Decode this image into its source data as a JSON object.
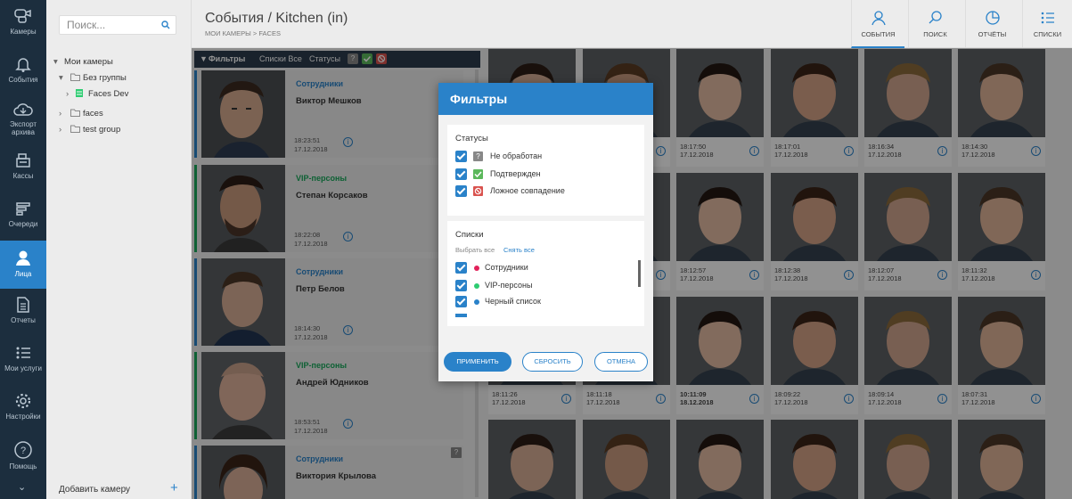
{
  "nav": {
    "items": [
      {
        "label": "Камеры",
        "icon": "cameras-icon"
      },
      {
        "label": "События",
        "icon": "bell-icon"
      },
      {
        "label": "Экспорт архива",
        "icon": "cloud-icon"
      },
      {
        "label": "Кассы",
        "icon": "cash-register-icon"
      },
      {
        "label": "Очереди",
        "icon": "queue-icon"
      },
      {
        "label": "Лица",
        "icon": "face-icon"
      },
      {
        "label": "Отчеты",
        "icon": "report-icon"
      },
      {
        "label": "Мои услуги",
        "icon": "services-icon"
      },
      {
        "label": "Настройки",
        "icon": "gear-icon"
      },
      {
        "label": "Помощь",
        "icon": "help-icon"
      }
    ],
    "active": "Лица"
  },
  "tree": {
    "search_placeholder": "Поиск...",
    "root": "Мои камеры",
    "nodes": [
      "Без группы",
      "Faces Dev",
      "faces",
      "test group"
    ],
    "add_camera": "Добавить камеру"
  },
  "header": {
    "title": "События / Kitchen (in)",
    "breadcrumb": "МОИ КАМЕРЫ > FACES",
    "tabs": [
      "СОБЫТИЯ",
      "ПОИСК",
      "ОТЧЁТЫ",
      "СПИСКИ"
    ]
  },
  "filterbar": {
    "filters": "Фильтры",
    "lists": "Списки Все",
    "statuses": "Статусы"
  },
  "events": [
    {
      "list": "Сотрудники",
      "name": "Виктор Мешков",
      "time": "18:23:51",
      "date": "17.12.2018"
    },
    {
      "list": "VIP-персоны",
      "name": "Степан Корсаков",
      "time": "18:22:08",
      "date": "17.12.2018"
    },
    {
      "list": "Сотрудники",
      "name": "Петр Белов",
      "time": "18:14:30",
      "date": "17.12.2018"
    },
    {
      "list": "VIP-персоны",
      "name": "Андрей Юдников",
      "time": "18:53:51",
      "date": "17.12.2018"
    },
    {
      "list": "Сотрудники",
      "name": "Виктория Крылова",
      "time": "",
      "date": ""
    }
  ],
  "grid": [
    [
      "",
      "17.12.2018"
    ],
    [
      "",
      "17.12.2018"
    ],
    [
      "18:17:50",
      "17.12.2018"
    ],
    [
      "18:17:01",
      "17.12.2018"
    ],
    [
      "18:16:34",
      "17.12.2018"
    ],
    [
      "18:14:30",
      "17.12.2018"
    ],
    [
      "",
      "17.12.2018"
    ],
    [
      "",
      "17.12.2018"
    ],
    [
      "18:12:57",
      "17.12.2018"
    ],
    [
      "18:12:38",
      "17.12.2018"
    ],
    [
      "18:12:07",
      "17.12.2018"
    ],
    [
      "18:11:32",
      "17.12.2018"
    ],
    [
      "18:11:26",
      "17.12.2018"
    ],
    [
      "18:11:18",
      "17.12.2018"
    ],
    [
      "10:11:09",
      "18.12.2018"
    ],
    [
      "18:09:22",
      "17.12.2018"
    ],
    [
      "18:09:14",
      "17.12.2018"
    ],
    [
      "18:07:31",
      "17.12.2018"
    ]
  ],
  "modal": {
    "title": "Фильтры",
    "statuses_title": "Статусы",
    "statuses": [
      "Не обработан",
      "Подтвержден",
      "Ложное совпадение"
    ],
    "lists_title": "Списки",
    "select_all": "Выбрать все",
    "deselect_all": "Снять все",
    "lists": [
      {
        "name": "Сотрудники",
        "color": "#e2215a"
      },
      {
        "name": "VIP-персоны",
        "color": "#2ecc71"
      },
      {
        "name": "Черный список",
        "color": "#2a82c9"
      }
    ],
    "apply": "ПРИМЕНИТЬ",
    "reset": "СБРОСИТЬ",
    "cancel": "ОТМЕНА"
  },
  "colors": {
    "accent": "#2a82c9",
    "vip": "#19a85b",
    "nav_bg": "#1c2e3e",
    "confirmed": "#5cb85c",
    "false_match": "#d9534f"
  }
}
